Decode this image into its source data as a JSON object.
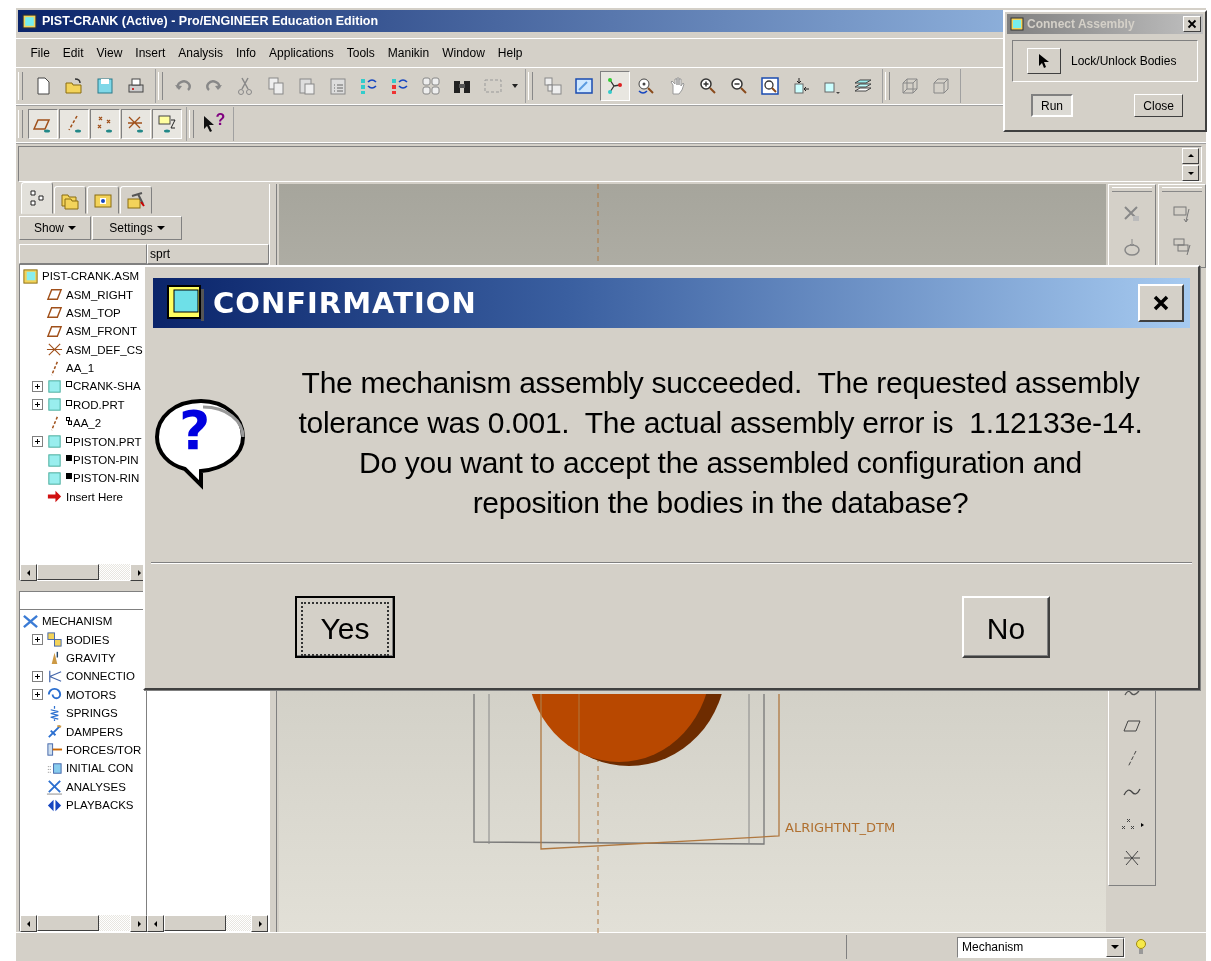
{
  "window": {
    "title": "PIST-CRANK (Active) - Pro/ENGINEER Education Edition"
  },
  "menu": [
    {
      "label": "File"
    },
    {
      "label": "Edit"
    },
    {
      "label": "View"
    },
    {
      "label": "Insert"
    },
    {
      "label": "Analysis"
    },
    {
      "label": "Info"
    },
    {
      "label": "Applications"
    },
    {
      "label": "Tools"
    },
    {
      "label": "Manikin"
    },
    {
      "label": "Window"
    },
    {
      "label": "Help"
    }
  ],
  "toolbar_rows": [
    [
      [
        {
          "kind": "new",
          "pressed": false
        },
        {
          "kind": "open",
          "pressed": false
        },
        {
          "kind": "save",
          "pressed": false
        },
        {
          "kind": "print",
          "pressed": false
        }
      ],
      [
        {
          "kind": "undo",
          "pressed": false
        },
        {
          "kind": "redo",
          "pressed": false
        },
        {
          "kind": "cut",
          "pressed": false
        },
        {
          "kind": "copy",
          "pressed": false
        },
        {
          "kind": "paste",
          "pressed": false
        },
        {
          "kind": "paste-special",
          "pressed": false
        },
        {
          "kind": "regen",
          "pressed": false
        },
        {
          "kind": "regen-manager",
          "pressed": false
        },
        {
          "kind": "group",
          "pressed": false
        },
        {
          "kind": "find",
          "pressed": false
        },
        {
          "kind": "select",
          "pressed": false
        },
        {
          "kind": "caret",
          "pressed": false
        }
      ],
      [
        {
          "kind": "layout",
          "pressed": false
        },
        {
          "kind": "repaint",
          "pressed": false
        },
        {
          "kind": "spin",
          "pressed": true
        },
        {
          "kind": "orient",
          "pressed": false
        },
        {
          "kind": "pan",
          "pressed": false
        },
        {
          "kind": "zoom-in",
          "pressed": false
        },
        {
          "kind": "zoom-out",
          "pressed": false
        },
        {
          "kind": "refit",
          "pressed": false
        },
        {
          "kind": "reorient",
          "pressed": false
        },
        {
          "kind": "views",
          "pressed": false
        },
        {
          "kind": "layers",
          "pressed": false
        }
      ],
      [
        {
          "kind": "wire",
          "pressed": false
        },
        {
          "kind": "hidden",
          "pressed": false
        }
      ]
    ],
    [
      [
        {
          "kind": "plane",
          "pressed": true
        },
        {
          "kind": "axis",
          "pressed": true
        },
        {
          "kind": "point",
          "pressed": true
        },
        {
          "kind": "csys",
          "pressed": true
        },
        {
          "kind": "note",
          "pressed": true
        }
      ],
      [
        {
          "kind": "help",
          "pressed": false,
          "glyph": "?"
        }
      ]
    ]
  ],
  "connect_assembly": {
    "title": "Connect Assembly",
    "lock_label": "Lock/Unlock Bodies",
    "buttons": [
      {
        "label": "Run",
        "default": true
      },
      {
        "label": "Close",
        "default": false
      }
    ]
  },
  "model_tree": {
    "tabs": [
      {
        "kind": "tree",
        "selected": true
      },
      {
        "kind": "folders",
        "selected": false
      },
      {
        "kind": "favorites",
        "selected": false
      },
      {
        "kind": "tools",
        "selected": false
      }
    ],
    "menus": [
      "Show",
      "Settings"
    ],
    "column_2": "sprt",
    "items": [
      {
        "kind": "asm",
        "label": "PIST-CRANK.ASM"
      },
      {
        "kind": "plane",
        "label": "ASM_RIGHT"
      },
      {
        "kind": "plane",
        "label": "ASM_TOP"
      },
      {
        "kind": "plane",
        "label": "ASM_FRONT"
      },
      {
        "kind": "csys",
        "label": "ASM_DEF_CS"
      },
      {
        "kind": "axis",
        "label": "AA_1"
      },
      {
        "kind": "part",
        "label": "CRANK-SHA",
        "expanded": false,
        "status_filled": false
      },
      {
        "kind": "part",
        "label": "ROD.PRT",
        "expanded": false,
        "status_filled": false
      },
      {
        "kind": "axis",
        "label": "AA_2",
        "linked": true
      },
      {
        "kind": "part",
        "label": "PISTON.PRT",
        "expanded": false,
        "status_filled": false
      },
      {
        "kind": "part",
        "label": "PISTON-PIN",
        "status_filled": true
      },
      {
        "kind": "part",
        "label": "PISTON-RIN",
        "status_filled": true
      },
      {
        "kind": "insert",
        "label": "Insert Here"
      }
    ]
  },
  "mechanism_tree": {
    "items": [
      {
        "kind": "mechanism",
        "label": "MECHANISM"
      },
      {
        "kind": "bodies",
        "label": "BODIES",
        "expanded": false
      },
      {
        "kind": "gravity",
        "label": "GRAVITY"
      },
      {
        "kind": "connections",
        "label": "CONNECTIO",
        "expanded": false
      },
      {
        "kind": "motors",
        "label": "MOTORS",
        "expanded": false
      },
      {
        "kind": "springs",
        "label": "SPRINGS"
      },
      {
        "kind": "dampers",
        "label": "DAMPERS"
      },
      {
        "kind": "forces",
        "label": "FORCES/TOR"
      },
      {
        "kind": "initial",
        "label": "INITIAL CON"
      },
      {
        "kind": "analyses",
        "label": "ANALYSES"
      },
      {
        "kind": "playbacks",
        "label": "PLAYBACKS"
      }
    ]
  },
  "graphics": {
    "datum_label": "ALRIGHTNT_DTM"
  },
  "confirmation": {
    "title": "CONFIRMATION",
    "glyph": "?",
    "message_lines": [
      "The mechanism assembly succeeded.  The requested assembly",
      "tolerance was 0.001.  The actual assembly error is  1.12133e-14.",
      "Do you want to accept the assembled configuration and",
      "reposition the bodies in the database?"
    ],
    "buttons": [
      {
        "label": "Yes",
        "focused": true
      },
      {
        "label": "No",
        "focused": false
      }
    ]
  },
  "status_bar": {
    "mode": "Mechanism"
  }
}
